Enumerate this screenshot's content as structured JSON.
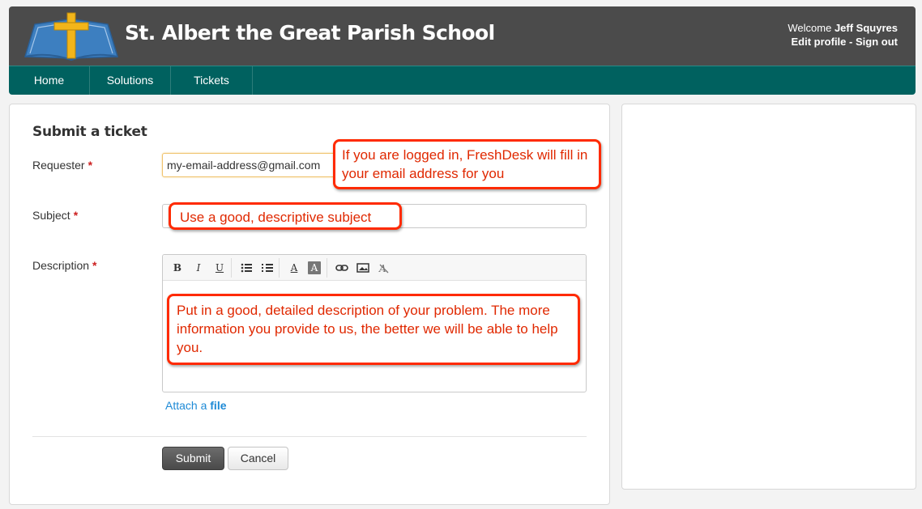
{
  "header": {
    "site_title": "St. Albert the Great Parish School",
    "welcome_prefix": "Welcome",
    "user_name": "Jeff Squyres",
    "edit_profile": "Edit profile",
    "separator": "-",
    "sign_out": "Sign out"
  },
  "nav": {
    "items": [
      {
        "label": "Home"
      },
      {
        "label": "Solutions"
      },
      {
        "label": "Tickets"
      }
    ]
  },
  "form": {
    "title": "Submit a ticket",
    "required_mark": "*",
    "requester": {
      "label": "Requester",
      "value": "my-email-address@gmail.com"
    },
    "subject": {
      "label": "Subject",
      "value": ""
    },
    "description": {
      "label": "Description"
    },
    "toolbar": {
      "bold": "B",
      "italic": "I",
      "underline": "U",
      "bullet_list": "unordered-list-icon",
      "numbered_list": "ordered-list-icon",
      "font_color": "A",
      "background_color": "A",
      "link": "link-icon",
      "image": "image-icon",
      "clear_format": "clear-format-icon"
    },
    "attach_prefix": "Attach a",
    "attach_link": "file",
    "submit": "Submit",
    "cancel": "Cancel"
  },
  "callouts": {
    "requester": "If you are logged in, FreshDesk will fill in your email address for you",
    "subject": "Use a good, descriptive subject",
    "description": "Put in a good, detailed description of your problem.  The more information you provide to us, the better we will be able to help you."
  },
  "colors": {
    "header_bg": "#4b4b4b",
    "nav_bg": "#00615f",
    "callout_border": "#ff2a00",
    "callout_text": "#e02800",
    "link": "#1e8ad6",
    "required": "#cc1f1f"
  }
}
